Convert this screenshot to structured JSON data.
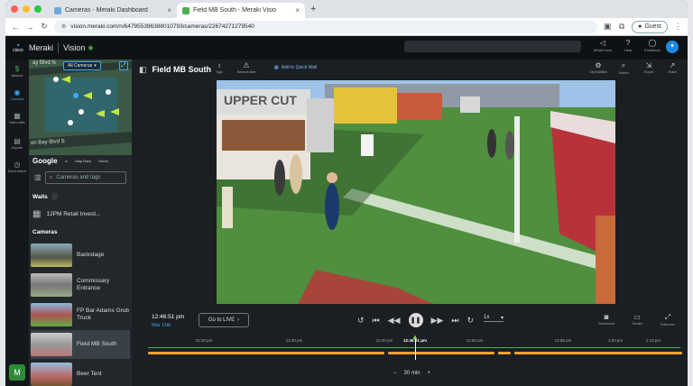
{
  "browser": {
    "tabs": [
      {
        "label": "Cameras - Meraki Dashboard",
        "favicon_color": "#6fa8dc"
      },
      {
        "label": "Field MB South - Meraki Visio",
        "favicon_color": "#4caf50"
      }
    ],
    "url": "vision.meraki.com/n/647955396388010793/cameras/22674271279540",
    "guest_label": "Guest"
  },
  "app": {
    "brand": "Meraki",
    "product": "Vision",
    "logo_text": "cisco",
    "header_items": [
      {
        "label": "What's new",
        "icon": "megaphone-icon"
      },
      {
        "label": "Help",
        "icon": "help-icon"
      },
      {
        "label": "Feedback",
        "icon": "feedback-icon"
      }
    ]
  },
  "rail": [
    {
      "label": "Network",
      "icon": "network-icon",
      "active": false
    },
    {
      "label": "Cameras",
      "icon": "camera-icon",
      "active": true
    },
    {
      "label": "Video walls",
      "icon": "grid-icon",
      "active": false
    },
    {
      "label": "Exports",
      "icon": "export-icon",
      "active": false
    },
    {
      "label": "Event search",
      "icon": "clock-icon",
      "active": false
    }
  ],
  "sidebar": {
    "map_filter": "All Cameras",
    "map_street_top": "ay Blvd N",
    "map_street_bottom": "on Bay Blvd S",
    "google": "Google",
    "map_data": "Map Data",
    "terms": "Terms",
    "search_placeholder": "Cameras and tags",
    "walls_heading": "Walls",
    "wall_item": "12PM Retail Invest...",
    "cameras_heading": "Cameras",
    "cameras": [
      {
        "name": "Backstage",
        "active": false
      },
      {
        "name": "Commissary Entrance",
        "active": false
      },
      {
        "name": "FP Bar Adams Grub Truck",
        "active": false
      },
      {
        "name": "Field MB South",
        "active": true
      },
      {
        "name": "Beer Tent",
        "active": false
      }
    ]
  },
  "main": {
    "title": "Field MB South",
    "tools": [
      {
        "label": "Tags",
        "icon": "tag-icon"
      },
      {
        "label": "Network alert",
        "icon": "alert-icon"
      }
    ],
    "add_wall": "Add to Quick Wall",
    "right_tools": [
      {
        "label": "Cfg Subtitles",
        "icon": "settings-icon"
      },
      {
        "label": "Search",
        "icon": "search-icon"
      },
      {
        "label": "Export",
        "icon": "export-icon"
      },
      {
        "label": "Share",
        "icon": "share-icon"
      }
    ],
    "video_sign": "UPPER CUT"
  },
  "playback": {
    "time": "12:46:51 pm",
    "date": "Mar 11th",
    "go_live": "Go to LIVE",
    "speed": "1x",
    "right_tools": [
      {
        "label": "Screenshot",
        "icon": "camera-icon"
      },
      {
        "label": "Theater",
        "icon": "theater-icon"
      },
      {
        "label": "Fullscreen",
        "icon": "fullscreen-icon"
      }
    ],
    "timeline_ticks": [
      "12:20 pm",
      "12:30 pm",
      "12:40 pm",
      "12:46:51 pm",
      "12:50 pm",
      "12:55 pm",
      "1:00 pm",
      "1:10 pm"
    ],
    "zoom_minus": "−",
    "zoom_label": "30 min",
    "zoom_plus": "+"
  }
}
